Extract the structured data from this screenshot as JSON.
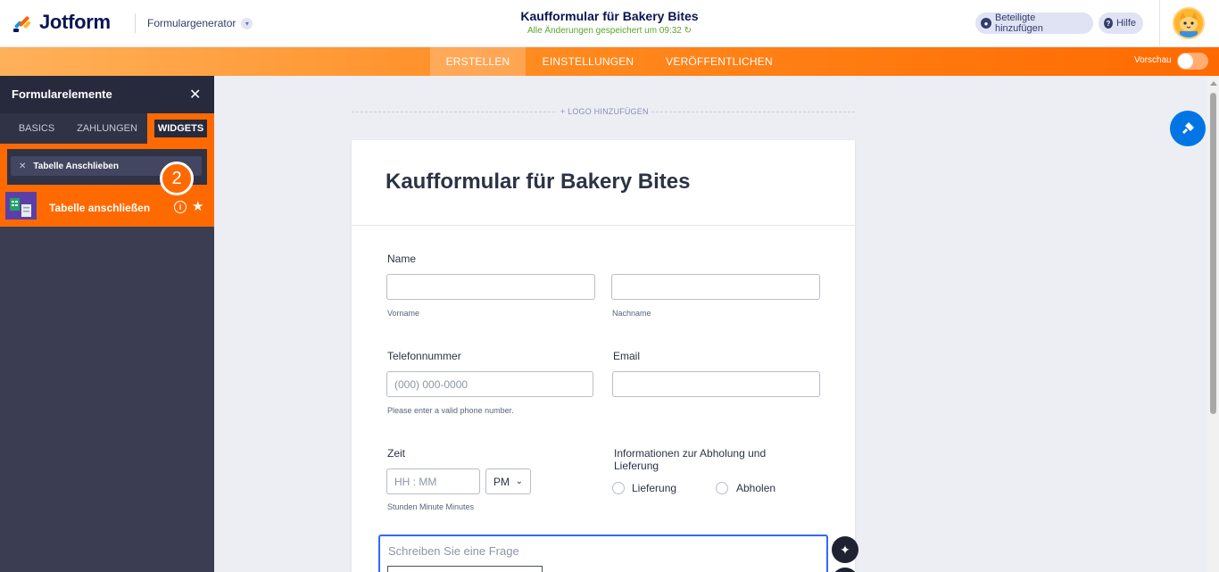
{
  "header": {
    "logo_text": "Jotform",
    "form_generator_label": "Formulargenerator",
    "form_title": "Kaufformular für Bakery Bites",
    "save_status": "Alle Änderungen gespeichert um 09:32",
    "add_participants_label": "Beteiligte hinzufügen",
    "help_label": "Hilfe"
  },
  "nav": {
    "tabs": [
      "ERSTELLEN",
      "EINSTELLUNGEN",
      "VERÖFFENTLICHEN"
    ],
    "active_tab": "ERSTELLEN",
    "preview_label": "Vorschau",
    "preview_enabled": false
  },
  "sidebar": {
    "title": "Formularelemente",
    "tabs": [
      "BASICS",
      "ZAHLUNGEN",
      "WIDGETS"
    ],
    "active_tab": "WIDGETS",
    "search_value": "Tabelle Anschlieben",
    "step_badge": "2",
    "result_label": "Tabelle anschließen"
  },
  "canvas": {
    "add_logo_label": "+ LOGO HINZUFÜGEN",
    "form_heading": "Kaufformular für Bakery Bites",
    "name_label": "Name",
    "firstname_sub": "Vorname",
    "lastname_sub": "Nachname",
    "phone_label": "Telefonnummer",
    "phone_placeholder": "(000) 000-0000",
    "phone_hint": "Please enter a valid phone number.",
    "email_label": "Email",
    "time_label": "Zeit",
    "time_placeholder": "HH : MM",
    "ampm_value": "PM",
    "time_sub": "Stunden Minute Minutes",
    "pickup_label": "Informationen zur Abholung und Lieferung",
    "pickup_options": [
      "Lieferung",
      "Abholen"
    ],
    "question_placeholder": "Schreiben Sie eine Frage"
  },
  "colors": {
    "accent_orange": "#ff6a00",
    "brand_navy": "#0a1551",
    "sidebar_bg": "#3b3e52",
    "save_green": "#59a52c",
    "focus_blue": "#2e69ff"
  },
  "icons": [
    "jotform-logo-icon",
    "chevron-down-icon",
    "user-icon",
    "help-icon",
    "close-icon",
    "search-clear-icon",
    "info-icon",
    "star-icon",
    "paint-roller-icon",
    "magic-wand-icon",
    "refresh-icon"
  ]
}
